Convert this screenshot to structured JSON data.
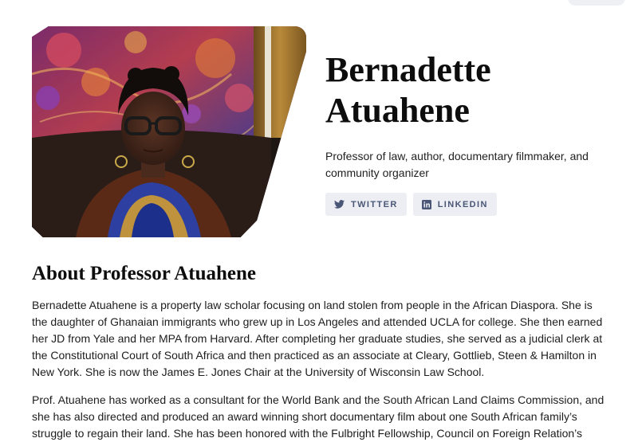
{
  "profile": {
    "name_line1": "Bernadette",
    "name_line2": "Atuahene",
    "tagline_line1": "Professor of law, author, documentary filmmaker, and",
    "tagline_line2": "community organizer"
  },
  "social": {
    "twitter_label": "TWITTER",
    "linkedin_label": "LINKEDIN",
    "accent": "#4a5676"
  },
  "about": {
    "title": "About Professor Atuahene",
    "p1": "Bernadette Atuahene is a property law scholar focusing on land stolen from people in the African Diaspora. She is the daughter of Ghanaian immigrants who grew up in Los Angeles and attended UCLA for college. She then earned her JD from Yale and her MPA from Harvard. After completing her graduate studies, she served as a judicial clerk at the Constitutional Court of South Africa and then practiced as an associate at Cleary, Gottlieb, Steen & Hamilton in New York. She is now the James E. Jones Chair at the University of Wisconsin Law School.",
    "p2": "Prof. Atuahene has worked as a consultant for the World Bank and the South African Land Claims Commission, and she has also directed and produced an award winning short documentary film about one South African family’s struggle to regain their land. She has been honored with the Fulbright Fellowship, Council on Foreign Relation’s"
  },
  "icons": {
    "twitter": "twitter-bird-icon",
    "linkedin": "linkedin-icon"
  }
}
